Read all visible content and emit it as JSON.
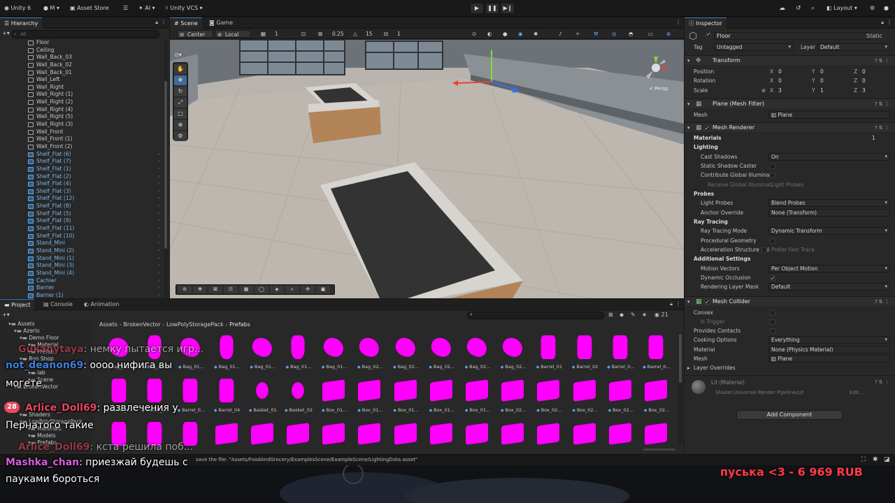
{
  "topbar": {
    "account": "Unity 6",
    "user_initial": "M",
    "asset_store": "Asset Store",
    "ai": "AI",
    "vcs": "Unity VCS",
    "layout": "Layout",
    "play_icon": "play-icon",
    "pause_icon": "pause-icon",
    "step_icon": "step-icon"
  },
  "hierarchy": {
    "tab": "Hierarchy",
    "search_placeholder": "All",
    "items": [
      {
        "name": "Floor",
        "prefab": false
      },
      {
        "name": "Ceiling",
        "prefab": false
      },
      {
        "name": "Wall_Back_03",
        "prefab": false
      },
      {
        "name": "Wall_Back_02",
        "prefab": false
      },
      {
        "name": "Wall_Back_01",
        "prefab": false
      },
      {
        "name": "Wall_Left",
        "prefab": false
      },
      {
        "name": "Wall_Right",
        "prefab": false
      },
      {
        "name": "Wall_Right (1)",
        "prefab": false
      },
      {
        "name": "Wall_Right (2)",
        "prefab": false
      },
      {
        "name": "Wall_Right (4)",
        "prefab": false
      },
      {
        "name": "Wall_Right (5)",
        "prefab": false
      },
      {
        "name": "Wall_Right (3)",
        "prefab": false
      },
      {
        "name": "Wall_Front",
        "prefab": false
      },
      {
        "name": "Wall_Front (1)",
        "prefab": false
      },
      {
        "name": "Wall_Front (2)",
        "prefab": false
      },
      {
        "name": "Shelf_Flat (6)",
        "prefab": true
      },
      {
        "name": "Shelf_Flat (7)",
        "prefab": true
      },
      {
        "name": "Shelf_Flat (1)",
        "prefab": true
      },
      {
        "name": "Shelf_Flat (2)",
        "prefab": true
      },
      {
        "name": "Shelf_Flat (4)",
        "prefab": true
      },
      {
        "name": "Shelf_Flat (3)",
        "prefab": true
      },
      {
        "name": "Shelf_Flat (12)",
        "prefab": true
      },
      {
        "name": "Shelf_Flat (8)",
        "prefab": true
      },
      {
        "name": "Shelf_Flat (5)",
        "prefab": true
      },
      {
        "name": "Shelf_Flat (9)",
        "prefab": true
      },
      {
        "name": "Shelf_Flat (11)",
        "prefab": true
      },
      {
        "name": "Shelf_Flat (10)",
        "prefab": true
      },
      {
        "name": "Stand_Mini",
        "prefab": true
      },
      {
        "name": "Stand_Mini (2)",
        "prefab": true
      },
      {
        "name": "Stand_Mini (1)",
        "prefab": true
      },
      {
        "name": "Stand_Mini (3)",
        "prefab": true
      },
      {
        "name": "Stand_Mini (4)",
        "prefab": true
      },
      {
        "name": "Cachier",
        "prefab": true
      },
      {
        "name": "Barrier",
        "prefab": true
      },
      {
        "name": "Barrier (1)",
        "prefab": true
      }
    ]
  },
  "scene": {
    "tab_scene": "Scene",
    "tab_game": "Game",
    "pivot": "Center",
    "space": "Local",
    "grid_value": "1",
    "snap_value": "0.25",
    "angle_value": "15",
    "scale_snap": "1",
    "gizmo_label": "< Persp"
  },
  "inspector": {
    "tab": "Inspector",
    "object_name": "Floor",
    "static_label": "Static",
    "tag_label": "Tag",
    "tag_value": "Untagged",
    "layer_label": "Layer",
    "layer_value": "Default",
    "transform": {
      "title": "Transform",
      "position_label": "Position",
      "position": [
        "0",
        "0",
        "0"
      ],
      "rotation_label": "Rotation",
      "rotation": [
        "0",
        "0",
        "0"
      ],
      "scale_label": "Scale",
      "scale": [
        "3",
        "1",
        "3"
      ]
    },
    "mesh_filter": {
      "title": "Plane (Mesh Filter)",
      "mesh_label": "Mesh",
      "mesh_value": "Plane"
    },
    "mesh_renderer": {
      "title": "Mesh Renderer",
      "materials_label": "Materials",
      "materials_count": "1",
      "lighting_label": "Lighting",
      "cast_shadows_label": "Cast Shadows",
      "cast_shadows_value": "On",
      "static_shadow_label": "Static Shadow Caster",
      "contribute_gi_label": "Contribute Global Illuminati",
      "receive_gi_label": "Receive Global Illuminati",
      "receive_gi_value": "Light Probes",
      "probes_label": "Probes",
      "light_probes_label": "Light Probes",
      "light_probes_value": "Blend Probes",
      "anchor_label": "Anchor Override",
      "anchor_value": "None (Transform)",
      "ray_tracing_label": "Ray Tracing",
      "rt_mode_label": "Ray Tracing Mode",
      "rt_mode_value": "Dynamic Transform",
      "procedural_label": "Procedural Geometry",
      "accel_label": "Acceleration Structure Bui",
      "accel_value": "Prefer Fast Trace",
      "additional_label": "Additional Settings",
      "motion_label": "Motion Vectors",
      "motion_value": "Per Object Motion",
      "dynamic_occ_label": "Dynamic Occlusion",
      "layer_mask_label": "Rendering Layer Mask",
      "layer_mask_value": "Default"
    },
    "mesh_collider": {
      "title": "Mesh Collider",
      "convex_label": "Convex",
      "is_trigger_label": "Is Trigger",
      "contacts_label": "Provides Contacts",
      "cooking_label": "Cooking Options",
      "cooking_value": "Everything",
      "material_label": "Material",
      "material_value": "None (Physics Material)",
      "mesh_label": "Mesh",
      "mesh_value": "Plane",
      "overrides_label": "Layer Overrides"
    },
    "material": {
      "name": "Lit (Material)",
      "shader_label": "Shader",
      "shader_value": "Universal Render Pipeline/Lit",
      "edit_label": "Edit..."
    },
    "add_component": "Add Component"
  },
  "project": {
    "tab_project": "Project",
    "tab_console": "Console",
    "tab_animation": "Animation",
    "tree": [
      "Assets",
      "Azerlo",
      "Demo Floor",
      "Material",
      "Prefab",
      "Ron Shop",
      "Mesh",
      "lab",
      "Scene",
      "BrokenVector",
      "Shaders",
      "LowPolyStoragePack",
      "Materials",
      "Models",
      "Prefabs"
    ],
    "breadcrumb": [
      "Assets",
      "BrokenVector",
      "LowPolyStoragePack",
      "Prefabs"
    ],
    "count": "21",
    "assets_row1": [
      "Bag_01...",
      "Bag_01...",
      "Bag_01...",
      "Bag_01...",
      "Bag_01...",
      "Bag_01...",
      "Bag_01...",
      "Bag_02...",
      "Bag_02...",
      "Bag_02...",
      "Bag_02...",
      "Bag_02...",
      "Barrel_01",
      "Barrel_02",
      "Barrel_0...",
      "Barrel_0..."
    ],
    "assets_row2": [
      "Barrel_0...",
      "Barrel_0...",
      "Barrel_0...",
      "Barrel_04",
      "Basket_01",
      "Basket_02",
      "Box_01...",
      "Box_01...",
      "Box_01...",
      "Box_01...",
      "Box_01...",
      "Box_02...",
      "Box_02...",
      "Box_02...",
      "Box_02...",
      "Box_02..."
    ],
    "assets_row3": [
      "",
      "",
      "",
      "",
      "",
      "",
      "",
      "",
      "",
      "",
      "",
      "",
      "",
      "",
      "",
      ""
    ]
  },
  "status": {
    "text": "save the file: \"Assets/FoodAndGrocery/ExamplesScene/ExampleScene/LightingData.asset\""
  },
  "stream": {
    "chat": [
      {
        "user": "Gukanytaya",
        "text": ": немку пытается игр..."
      },
      {
        "user": "not_deanon69",
        "text": ": оооо нифига вы"
      },
      {
        "user": "",
        "text": "могете"
      },
      {
        "user": "Arlice_Doll69",
        "text": ": развлечения у"
      },
      {
        "user": "",
        "text": "Пернатого такие"
      },
      {
        "user": "Arlice_Doll69",
        "text": ": кста решила поб..."
      },
      {
        "user": "Mashka_chan",
        "text": ": приезжай будешь с"
      },
      {
        "user": "",
        "text": "пауками бороться"
      }
    ],
    "badge_number": "28",
    "donation": "пуська <3 - 6 969 RUB"
  },
  "colors": {
    "accent": "#3a79bb",
    "prefab_blue": "#7cb7ea",
    "missing_material": "#ff00ff",
    "donation_red": "#ff3b47"
  }
}
